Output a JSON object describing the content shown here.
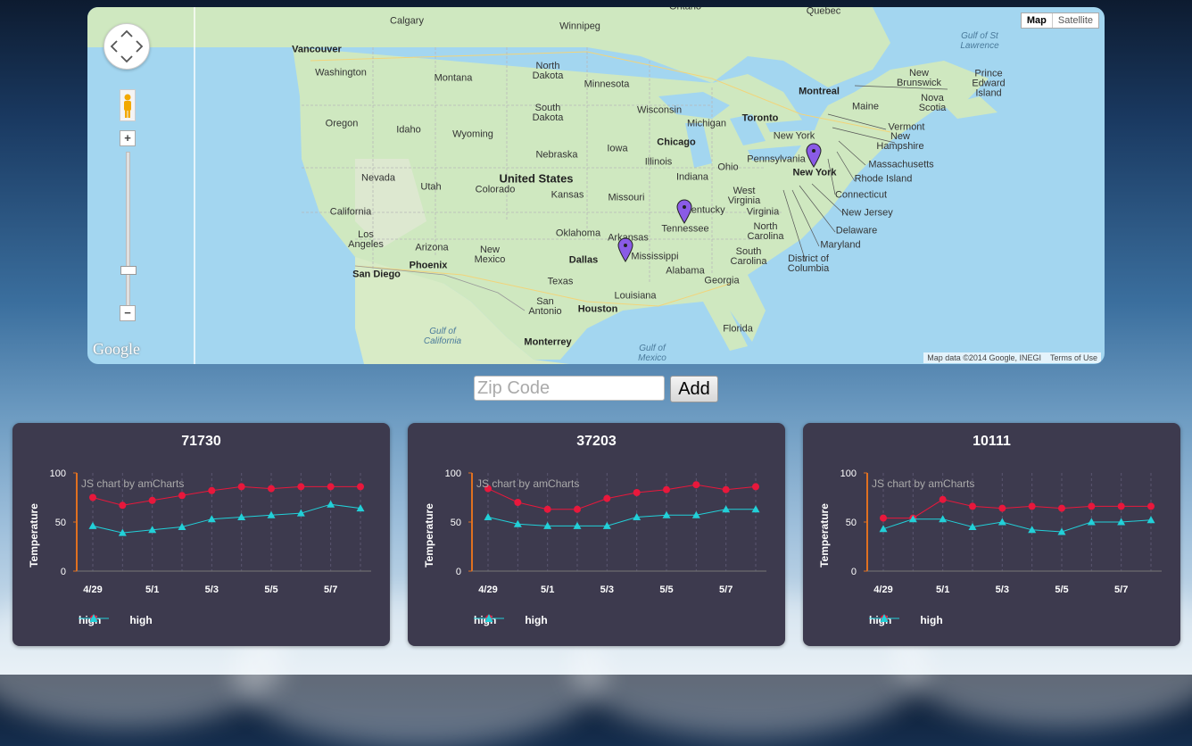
{
  "map": {
    "type_buttons": [
      "Map",
      "Satellite"
    ],
    "active_type": "Map",
    "zoom_in": "+",
    "zoom_out": "−",
    "logo": "Google",
    "attribution": "Map data ©2014 Google, INEGI",
    "terms": "Terms of Use",
    "labels": {
      "calgary": "Calgary",
      "winnipeg": "Winnipeg",
      "quebec": "Quebec",
      "ontario": "Ontario",
      "gulf_st_lawrence": "Gulf of St\nLawrence",
      "vancouver": "Vancouver",
      "washington": "Washington",
      "montana": "Montana",
      "north_dakota": "North\nDakota",
      "minnesota": "Minnesota",
      "new_brunswick": "New\nBrunswick",
      "prince_edward": "Prince\nEdward\nIsland",
      "nova_scotia": "Nova\nScotia",
      "montreal": "Montreal",
      "maine": "Maine",
      "oregon": "Oregon",
      "idaho": "Idaho",
      "south_dakota": "South\nDakota",
      "wisconsin": "Wisconsin",
      "michigan": "Michigan",
      "toronto": "Toronto",
      "vermont": "Vermont",
      "new_hampshire": "New\nHampshire",
      "wyoming": "Wyoming",
      "new_york_state": "New York",
      "chicago": "Chicago",
      "iowa": "Iowa",
      "nebraska": "Nebraska",
      "illinois": "Illinois",
      "ohio": "Ohio",
      "pennsylvania": "Pennsylvania",
      "new_york_city": "New York",
      "massachusetts": "Massachusetts",
      "rhode_island": "Rhode Island",
      "nevada": "Nevada",
      "utah": "Utah",
      "united_states": "United States",
      "colorado": "Colorado",
      "indiana": "Indiana",
      "connecticut": "Connecticut",
      "kansas": "Kansas",
      "missouri": "Missouri",
      "west_virginia": "West\nVirginia",
      "california": "California",
      "kentucky": "Kentucky",
      "virginia": "Virginia",
      "new_jersey": "New Jersey",
      "tennessee": "Tennessee",
      "delaware": "Delaware",
      "oklahoma": "Oklahoma",
      "arkansas": "Arkansas",
      "north_carolina": "North\nCarolina",
      "los_angeles": "Los\nAngeles",
      "arizona": "Arizona",
      "new_mexico": "New\nMexico",
      "maryland": "Maryland",
      "mississippi": "Mississippi",
      "dallas": "Dallas",
      "south_carolina": "South\nCarolina",
      "phoenix": "Phoenix",
      "district_of_columbia": "District of\nColumbia",
      "alabama": "Alabama",
      "san_diego": "San Diego",
      "texas": "Texas",
      "georgia": "Georgia",
      "louisiana": "Louisiana",
      "san_antonio": "San\nAntonio",
      "houston": "Houston",
      "gulf_california": "Gulf of\nCalifornia",
      "florida": "Florida",
      "monterrey": "Monterrey",
      "gulf_mexico": "Gulf of\nMexico"
    },
    "pin_color": "#8a5be6"
  },
  "zip": {
    "placeholder": "Zip Code",
    "button": "Add"
  },
  "colors": {
    "high1": "#e8183c",
    "high2": "#22d0d8",
    "axis": "#e07020",
    "card": "#3d3a4e"
  },
  "chart_data": [
    {
      "type": "line",
      "title": "71730",
      "watermark": "JS chart by amCharts",
      "ylabel": "Temperature",
      "ylim": [
        0,
        100
      ],
      "yticks": [
        "100",
        "50",
        "0"
      ],
      "x": [
        "4/29",
        "4/30",
        "5/1",
        "5/2",
        "5/3",
        "5/4",
        "5/5",
        "5/6",
        "5/7",
        "5/8"
      ],
      "xtick_labels": [
        "4/29",
        "5/1",
        "5/3",
        "5/5",
        "5/7"
      ],
      "series": [
        {
          "name": "high",
          "marker": "circle",
          "values": [
            75,
            67,
            72,
            77,
            82,
            86,
            84,
            86,
            86,
            86
          ]
        },
        {
          "name": "high",
          "marker": "triangle",
          "values": [
            46,
            39,
            42,
            45,
            53,
            55,
            57,
            59,
            68,
            64
          ]
        }
      ]
    },
    {
      "type": "line",
      "title": "37203",
      "watermark": "JS chart by amCharts",
      "ylabel": "Temperature",
      "ylim": [
        0,
        100
      ],
      "yticks": [
        "100",
        "50",
        "0"
      ],
      "x": [
        "4/29",
        "4/30",
        "5/1",
        "5/2",
        "5/3",
        "5/4",
        "5/5",
        "5/6",
        "5/7",
        "5/8"
      ],
      "xtick_labels": [
        "4/29",
        "5/1",
        "5/3",
        "5/5",
        "5/7"
      ],
      "series": [
        {
          "name": "high",
          "marker": "circle",
          "values": [
            84,
            70,
            63,
            63,
            74,
            80,
            83,
            88,
            83,
            86
          ]
        },
        {
          "name": "high",
          "marker": "triangle",
          "values": [
            55,
            48,
            46,
            46,
            46,
            55,
            57,
            57,
            63,
            63
          ]
        }
      ]
    },
    {
      "type": "line",
      "title": "10111",
      "watermark": "JS chart by amCharts",
      "ylabel": "Temperature",
      "ylim": [
        0,
        100
      ],
      "yticks": [
        "100",
        "50",
        "0"
      ],
      "x": [
        "4/29",
        "4/30",
        "5/1",
        "5/2",
        "5/3",
        "5/4",
        "5/5",
        "5/6",
        "5/7",
        "5/8"
      ],
      "xtick_labels": [
        "4/29",
        "5/1",
        "5/3",
        "5/5",
        "5/7"
      ],
      "series": [
        {
          "name": "high",
          "marker": "circle",
          "values": [
            54,
            54,
            73,
            66,
            64,
            66,
            64,
            66,
            66,
            66
          ]
        },
        {
          "name": "high",
          "marker": "triangle",
          "values": [
            43,
            53,
            53,
            45,
            50,
            42,
            40,
            50,
            50,
            52
          ]
        }
      ]
    }
  ]
}
